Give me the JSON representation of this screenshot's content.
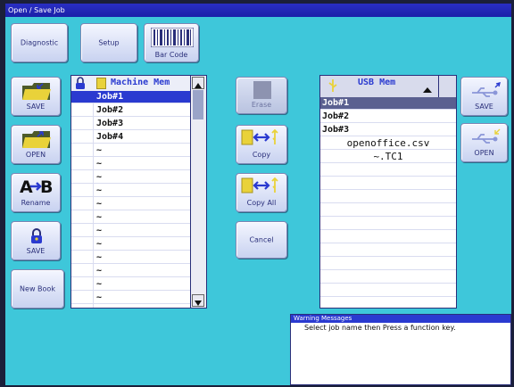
{
  "window": {
    "title": "Open / Save Job"
  },
  "top_buttons": {
    "diagnostic": "Diagnostic",
    "setup": "Setup",
    "barcode": "Bar Code"
  },
  "left_buttons": {
    "save": "SAVE",
    "open": "OPEN",
    "rename": "Rename",
    "save_lock": "SAVE",
    "new_book": "New Book"
  },
  "machine_list": {
    "header": "Machine Mem",
    "items": [
      "Job#1",
      "Job#2",
      "Job#3",
      "Job#4"
    ],
    "empty_marker": "~"
  },
  "middle_buttons": {
    "erase": "Erase",
    "copy": "Copy",
    "copy_all": "Copy All",
    "cancel": "Cancel"
  },
  "usb_list": {
    "header": "USB Mem",
    "items": [
      "Job#1",
      "Job#2",
      "Job#3",
      "openoffice.csv",
      "~.TC1"
    ]
  },
  "right_buttons": {
    "save": "SAVE",
    "open": "OPEN"
  },
  "warning": {
    "title": "Warning Messages",
    "message": "Select job name then Press a function key."
  },
  "colors": {
    "background": "#3ec7da",
    "selection": "#2a3ad0",
    "folder": "#e9d23a",
    "title_bar": "#1a20a8"
  }
}
